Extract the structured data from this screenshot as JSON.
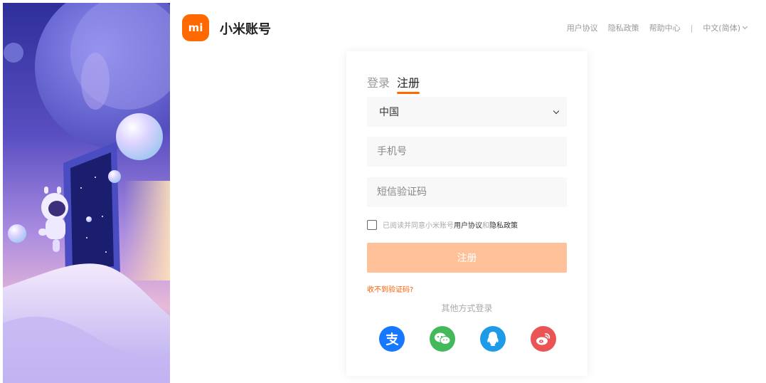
{
  "header": {
    "logo_text": "mi",
    "brand": "小米账号",
    "links": [
      "用户协议",
      "隐私政策",
      "帮助中心"
    ],
    "separator": "|",
    "language": "中文(简体)"
  },
  "card": {
    "tabs": [
      "登录",
      "注册"
    ],
    "active_tab": "注册",
    "country": "中国",
    "phone_placeholder": "手机号",
    "code_placeholder": "短信验证码",
    "agree_prefix": "已阅读并同意小米账号",
    "agree_terms": "用户协议",
    "agree_and": "和",
    "agree_privacy": "隐私政策",
    "submit_label": "注册",
    "no_code_link": "收不到验证码?",
    "other_login": "其他方式登录",
    "socials": [
      "alipay",
      "wechat",
      "qq",
      "weibo"
    ]
  },
  "colors": {
    "brand": "#ff6900",
    "submit_disabled": "#ffc19a",
    "alipay": "#1677ff",
    "wechat": "#43b95b",
    "qq": "#1e9be8",
    "weibo": "#ea5455"
  }
}
